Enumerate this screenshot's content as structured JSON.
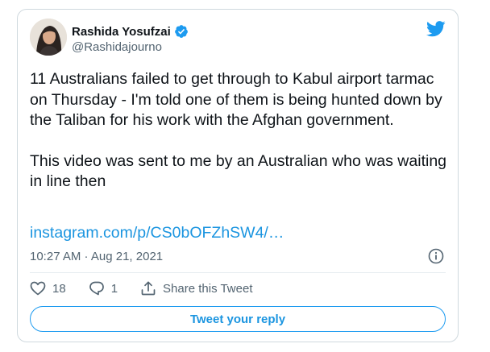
{
  "tweet": {
    "author": {
      "name": "Rashida Yosufzai",
      "handle": "@Rashidajourno",
      "verified": true
    },
    "text_paragraphs": [
      "11 Australians failed to get through to Kabul airport tarmac on Thursday - I'm told one of them is being hunted down by the Taliban for his work with the Afghan government.",
      "This video was sent to me by an Australian who was waiting in line then"
    ],
    "link": "instagram.com/p/CS0bOFZhSW4/…",
    "timestamp": "10:27 AM · Aug 21, 2021",
    "likes": "18",
    "replies": "1",
    "share_label": "Share this Tweet",
    "reply_button_label": "Tweet your reply"
  },
  "icons": {
    "brand": "twitter-bird-icon",
    "verified": "verified-badge-icon",
    "info": "info-icon",
    "like": "heart-icon",
    "reply": "reply-bubble-icon",
    "share": "share-icon"
  },
  "colors": {
    "accent": "#1d9bf0",
    "link": "#1b95e0",
    "text": "#0f1419",
    "muted": "#536471",
    "border": "#cfd9de"
  }
}
